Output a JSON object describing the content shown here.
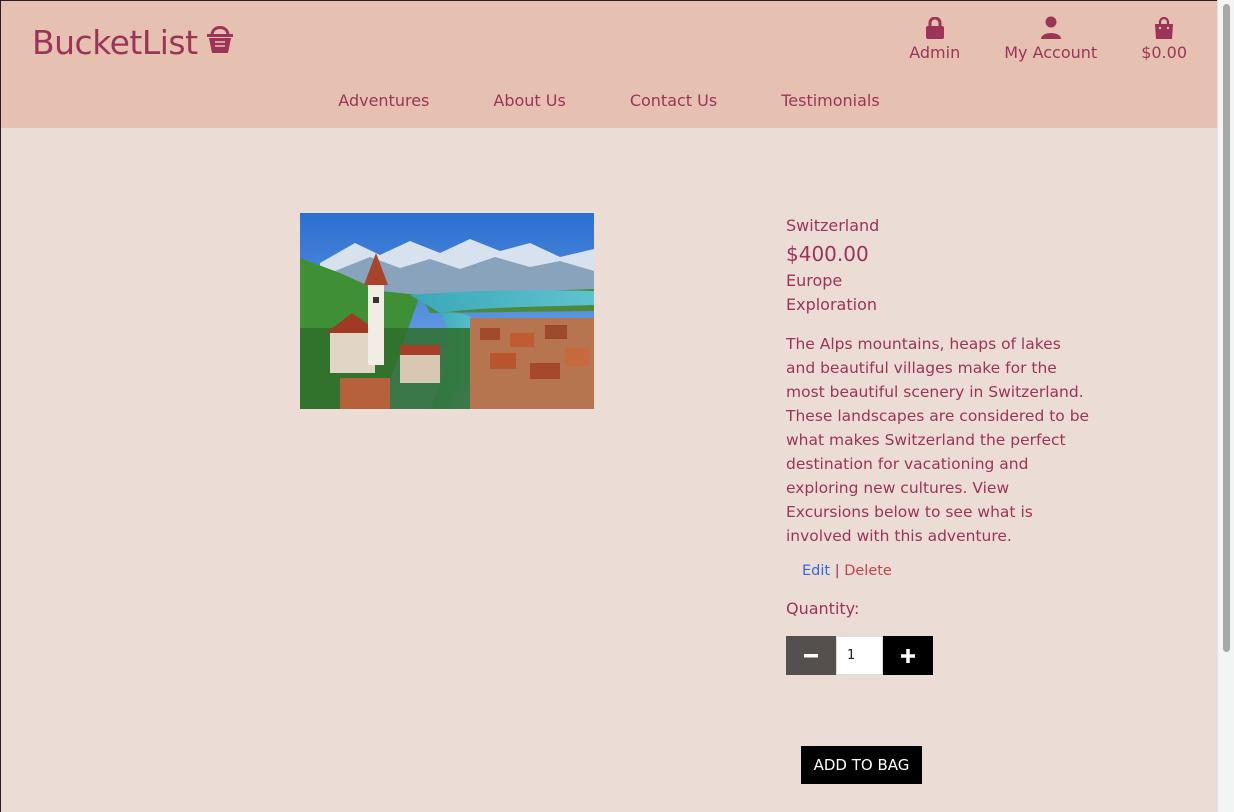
{
  "brand": {
    "name": "BucketList"
  },
  "top_links": [
    {
      "label": "Admin",
      "icon": "lock-icon"
    },
    {
      "label": "My Account",
      "icon": "user-icon"
    },
    {
      "label": "$0.00",
      "icon": "shopping-bag-icon"
    }
  ],
  "nav": [
    "Adventures",
    "About Us",
    "Contact Us",
    "Testimonials"
  ],
  "product": {
    "name": "Switzerland",
    "price": "$400.00",
    "region": "Europe",
    "category": "Exploration",
    "description": "The Alps mountains, heaps of lakes and beautiful villages make for the most beautiful scenery in Switzerland. These landscapes are considered to be what makes Switzerland the perfect destination for vacationing and exploring new cultures. View Excursions below to see what is involved with this adventure.",
    "edit_label": "Edit",
    "separator": "|",
    "delete_label": "Delete",
    "quantity_label": "Quantity:",
    "quantity_value": "1",
    "add_to_bag_label": "ADD TO BAG"
  },
  "colors": {
    "brand": "#9b3458",
    "header_bg": "#e6c1b2",
    "page_bg": "#ecdcd6",
    "edit_link": "#2f68d8",
    "delete_link": "#c24545"
  }
}
